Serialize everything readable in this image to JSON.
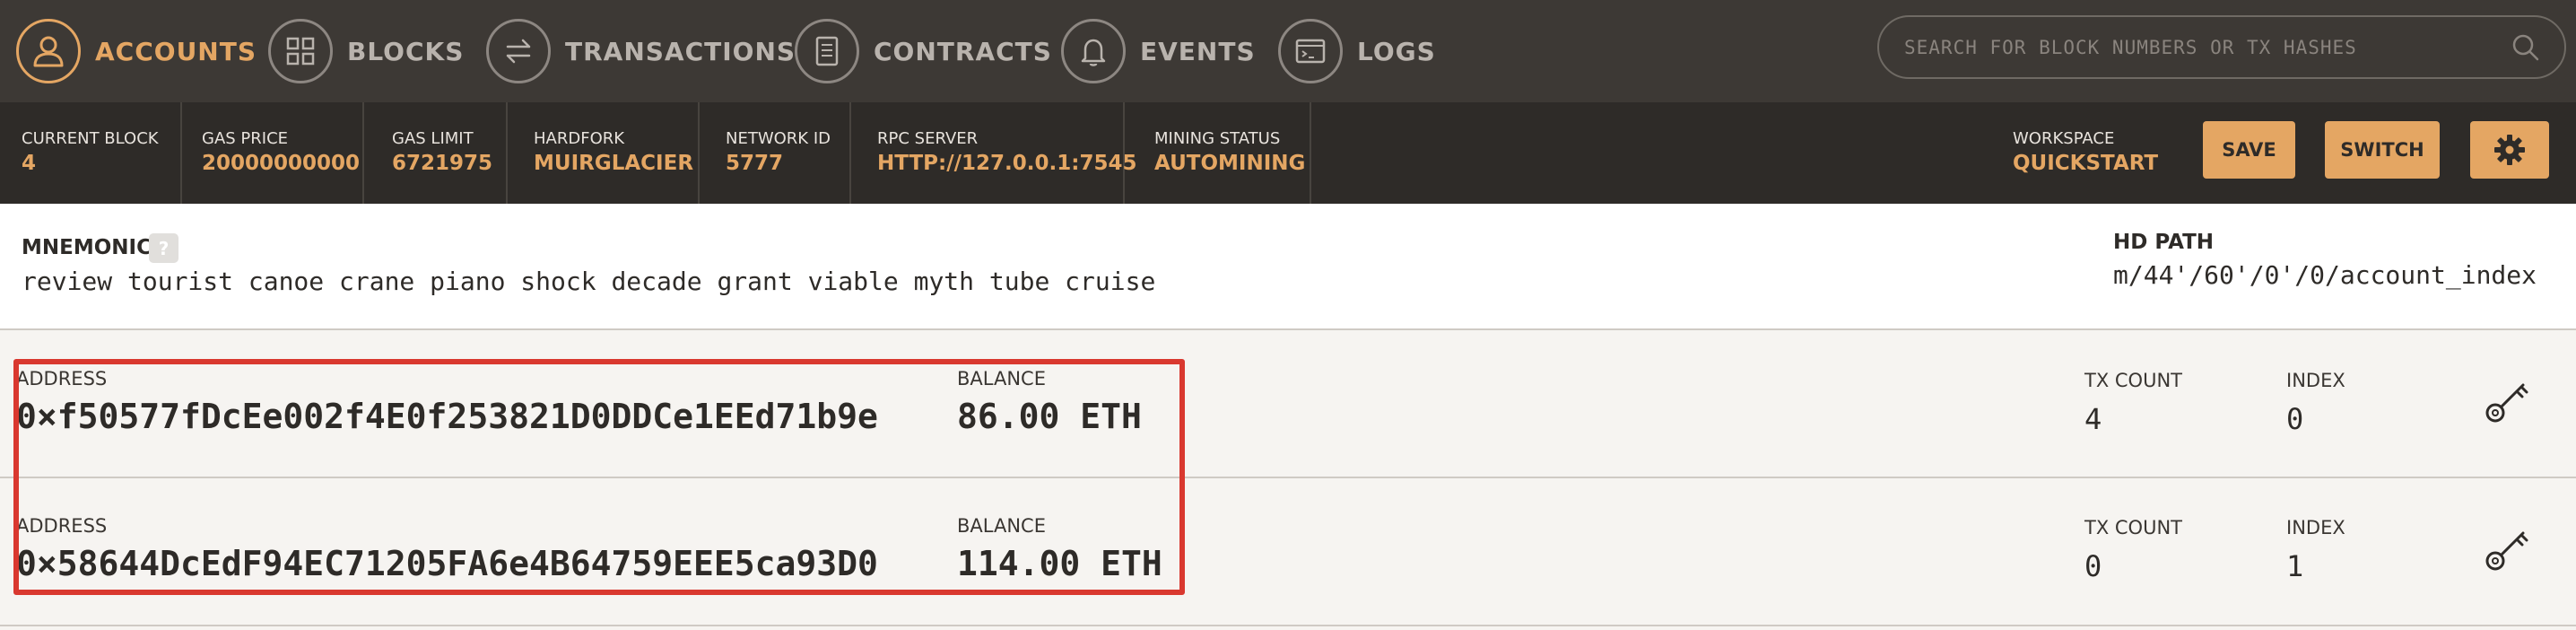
{
  "nav": {
    "items": [
      {
        "label": "Accounts",
        "icon": "user-icon",
        "active": true
      },
      {
        "label": "Blocks",
        "icon": "grid-icon",
        "active": false
      },
      {
        "label": "Transactions",
        "icon": "arrows-swap-icon",
        "active": false
      },
      {
        "label": "Contracts",
        "icon": "document-icon",
        "active": false
      },
      {
        "label": "Events",
        "icon": "bell-icon",
        "active": false
      },
      {
        "label": "Logs",
        "icon": "terminal-icon",
        "active": false
      }
    ],
    "search": {
      "placeholder": "SEARCH FOR BLOCK NUMBERS OR TX HASHES",
      "icon": "search-icon"
    }
  },
  "status": {
    "current_block": {
      "label": "Current Block",
      "value": "4"
    },
    "gas_price": {
      "label": "Gas Price",
      "value": "20000000000"
    },
    "gas_limit": {
      "label": "Gas Limit",
      "value": "6721975"
    },
    "hardfork": {
      "label": "Hardfork",
      "value": "MUIRGLACIER"
    },
    "network_id": {
      "label": "Network ID",
      "value": "5777"
    },
    "rpc_server": {
      "label": "RPC Server",
      "value": "HTTP://127.0.0.1:7545"
    },
    "mining_status": {
      "label": "Mining Status",
      "value": "AUTOMINING"
    },
    "workspace": {
      "label": "Workspace",
      "value": "QUICKSTART"
    },
    "save_label": "Save",
    "switch_label": "Switch",
    "settings_icon": "gear-icon"
  },
  "mnemonic": {
    "label": "Mnemonic",
    "help": "?",
    "words": "review tourist canoe crane piano shock decade grant viable myth tube cruise",
    "hd_path_label": "HD Path",
    "hd_path": "m/44'/60'/0'/0/account_index"
  },
  "accounts": {
    "address_label": "Address",
    "balance_label": "Balance",
    "tx_count_label": "TX Count",
    "index_label": "Index",
    "key_icon": "key-icon",
    "rows": [
      {
        "address": "0×f50577fDcEe002f4E0f253821D0DDCe1EEd71b9e",
        "balance": "86.00 ETH",
        "tx_count": "4",
        "index": "0"
      },
      {
        "address": "0×58644DcEdF94EC71205FA6e4B64759EEE5ca93D0",
        "balance": "114.00 ETH",
        "tx_count": "0",
        "index": "1"
      }
    ]
  },
  "colors": {
    "accent": "#e4a663",
    "nav_bg": "#3d3935",
    "status_bg": "#2e2b28",
    "highlight": "#d9382f"
  }
}
